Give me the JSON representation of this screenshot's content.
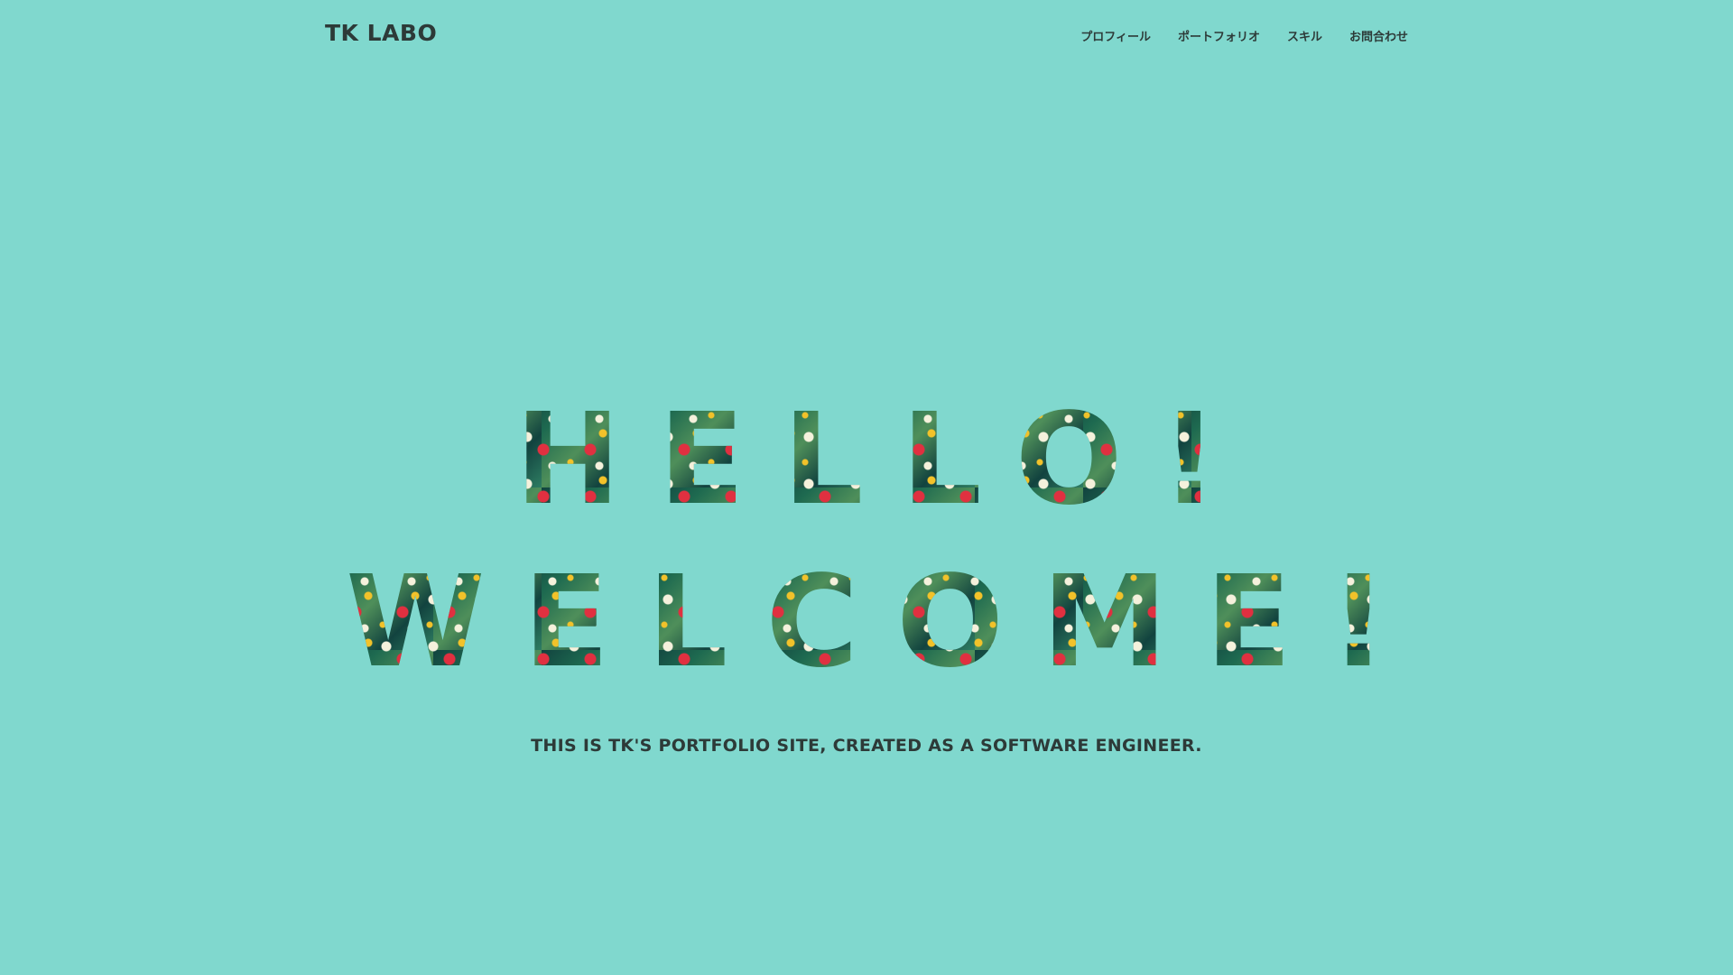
{
  "header": {
    "logo": "TK LABO",
    "nav": [
      {
        "label": "プロフィール"
      },
      {
        "label": "ポートフォリオ"
      },
      {
        "label": "スキル"
      },
      {
        "label": "お問合わせ"
      }
    ]
  },
  "hero": {
    "line1": "HELLO!",
    "line2": "WELCOME!",
    "subtitle": "THIS IS TK'S PORTFOLIO SITE, CREATED AS A SOFTWARE ENGINEER."
  },
  "colors": {
    "background": "#80d8ce",
    "text": "#2d3a38",
    "floral_dark": "#12433f",
    "floral_red": "#e03040",
    "floral_yellow": "#f2c22a",
    "floral_white": "#f5f1dc"
  }
}
